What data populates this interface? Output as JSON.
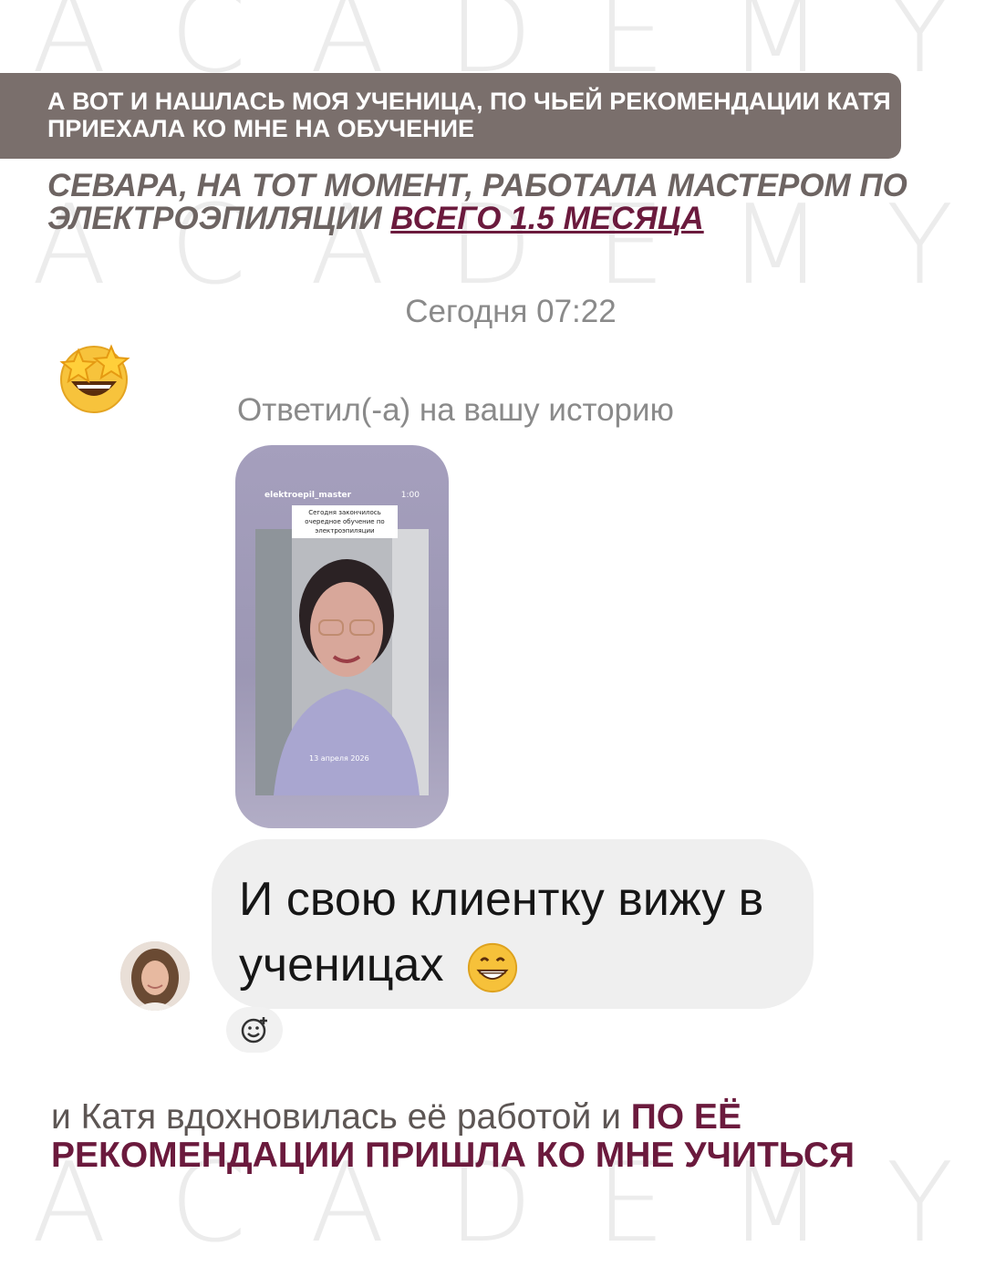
{
  "watermark": {
    "letters_top": [
      "A",
      "C",
      "A",
      "D",
      "E",
      "M",
      "Y"
    ],
    "letters_mid": [
      "A",
      "C",
      "A",
      "D",
      "E",
      "M",
      "Y"
    ],
    "letters_bottom": [
      "A",
      "C",
      "A",
      "D",
      "E",
      "M",
      "Y"
    ]
  },
  "banner": {
    "text": "А вот и нашлась моя ученица, по чьей рекомендации Катя приехала ко мне на обучение"
  },
  "subhead": {
    "text": "Севара, на тот момент, работала мастером по электроэпиляции ",
    "accent": "всего 1.5 месяца"
  },
  "chat": {
    "timestamp": "Сегодня 07:22",
    "replied_label": "Ответил(-а) на вашу историю",
    "story": {
      "username": "elektroepil_master",
      "time": "1:00",
      "caption": "Сегодня закончилось очередное обучение по электроэпиляции",
      "date": "13 апреля 2026"
    },
    "message": "И свою клиентку вижу в ученицах",
    "icons": {
      "reaction": "star-struck-emoji",
      "message_emoji": "grinning-emoji",
      "react_button": "add-reaction-icon"
    }
  },
  "footer": {
    "text": "и Катя вдохновилась её работой и ",
    "strong": "по её рекомендации пришла ко мне учиться"
  },
  "colors": {
    "banner_bg": "#7a6f6c",
    "accent": "#6b1a3d",
    "bubble_bg": "#efefef"
  }
}
